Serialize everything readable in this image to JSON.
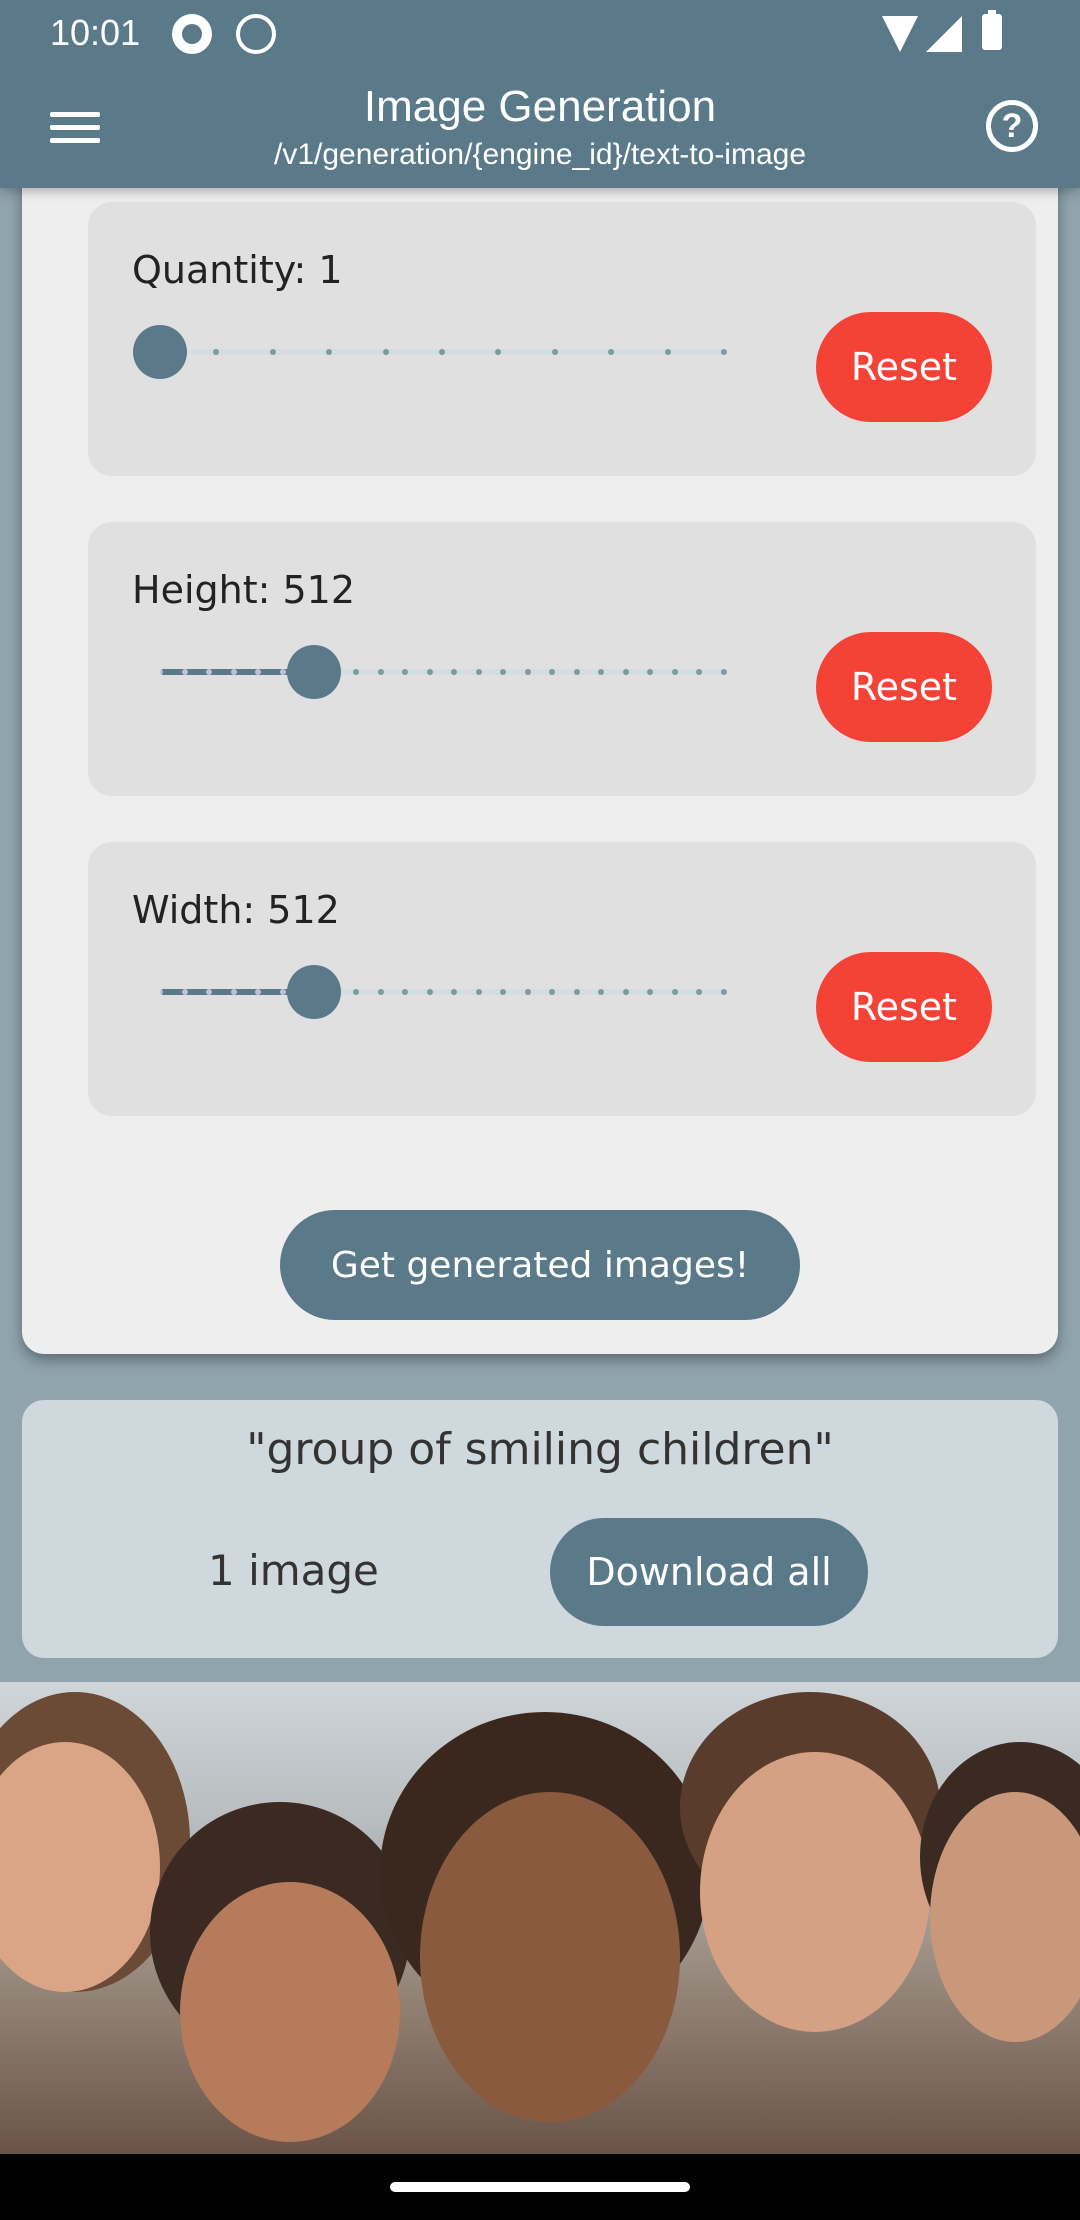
{
  "status_bar": {
    "time": "10:01"
  },
  "app_bar": {
    "title": "Image Generation",
    "subtitle": "/v1/generation/{engine_id}/text-to-image"
  },
  "settings": [
    {
      "label": "Quantity: 1",
      "value": 1,
      "min": 1,
      "max": 10,
      "reset_label": "Reset"
    },
    {
      "label": "Height: 512",
      "value": 512,
      "min": 128,
      "max": 1536,
      "reset_label": "Reset"
    },
    {
      "label": "Width: 512",
      "value": 512,
      "min": 128,
      "max": 1536,
      "reset_label": "Reset"
    }
  ],
  "generate_button": "Get generated images!",
  "result": {
    "prompt": "\"group of smiling children\"",
    "count": "1 image",
    "download_label": "Download all"
  },
  "colors": {
    "primary": "#5a7a8a",
    "reset": "#f44336",
    "card": "#e0e0e0"
  }
}
